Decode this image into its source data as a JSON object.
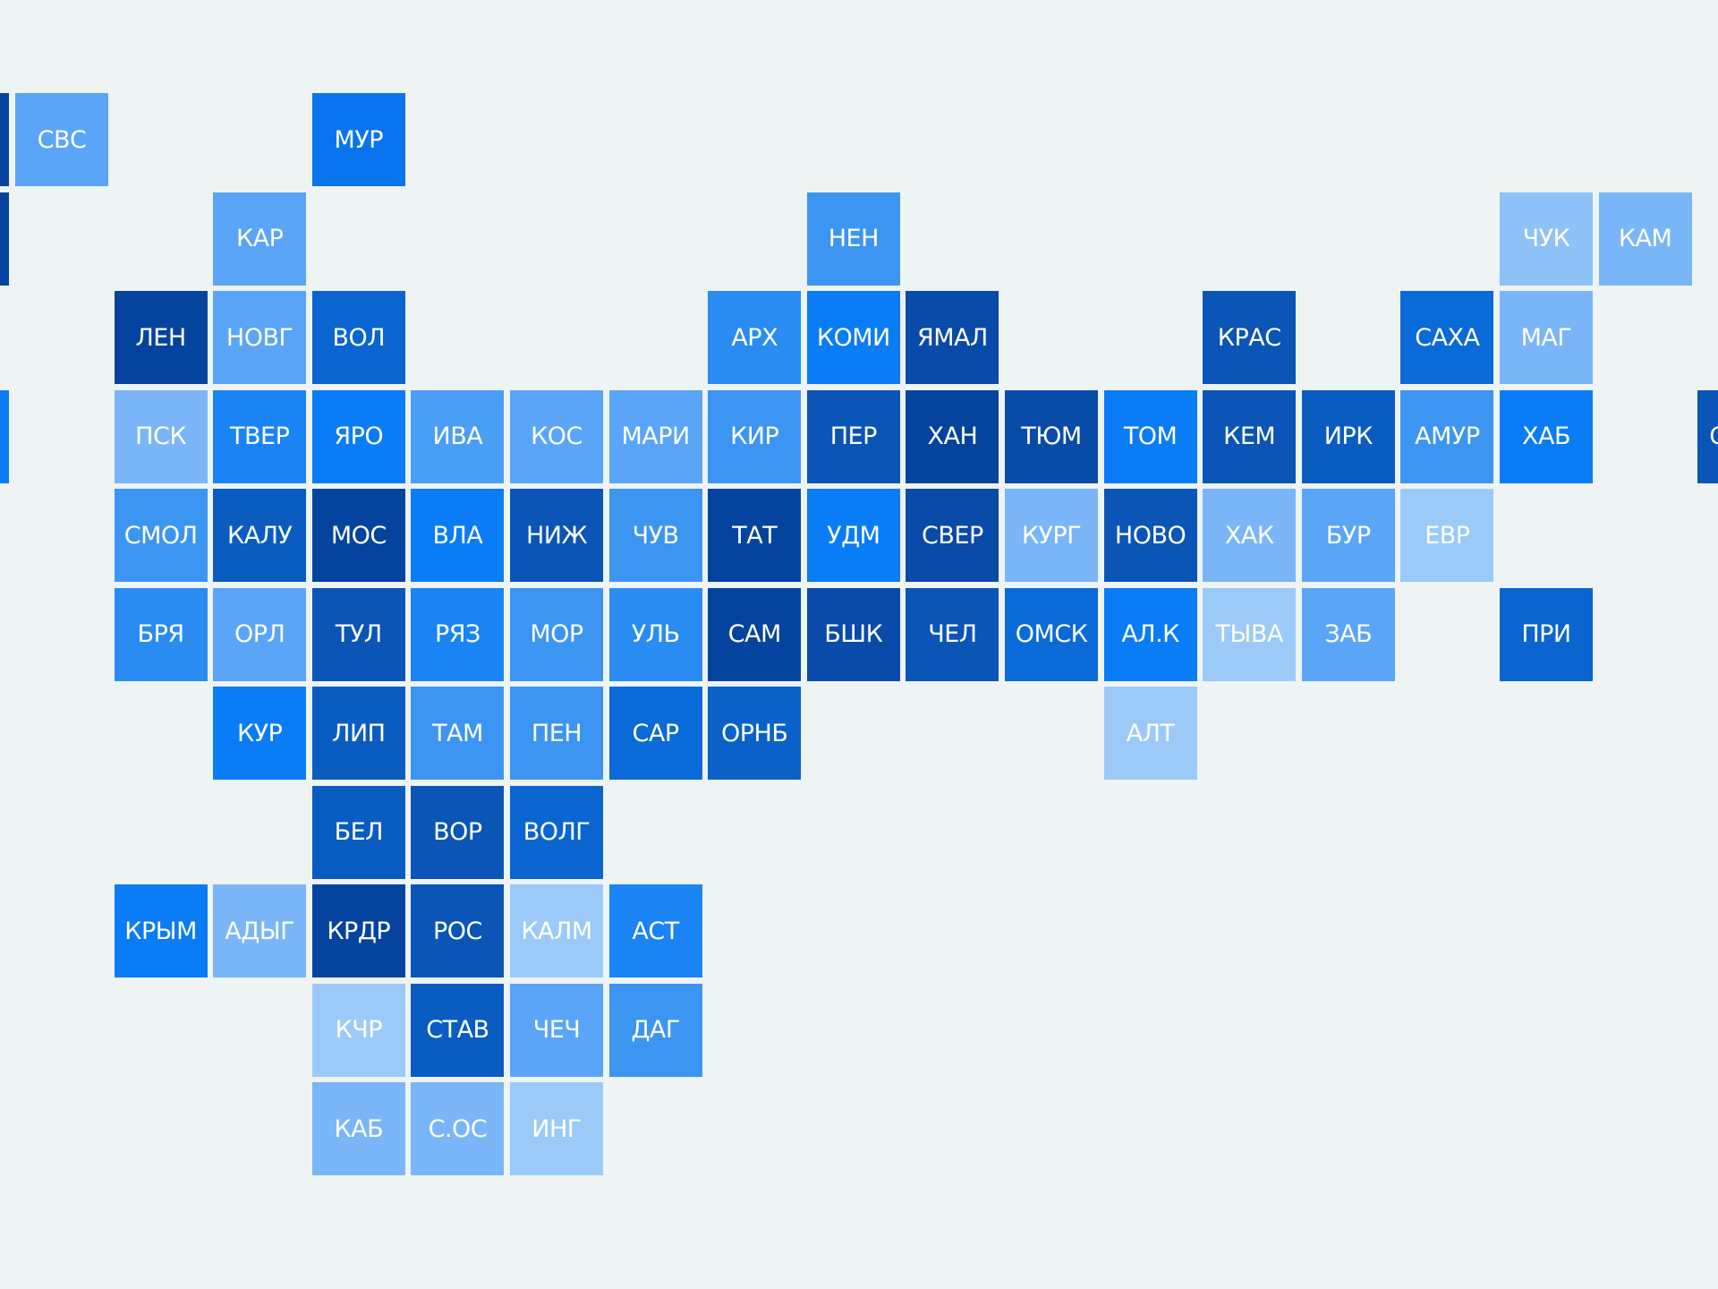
{
  "tiles": [
    {
      "label": "",
      "color": "#05449e"
    },
    {
      "label": "СВС",
      "color": "#5aa5f7"
    },
    {
      "label": "МУР",
      "color": "#0a74ee"
    },
    {
      "label": "",
      "color": "#05449e"
    },
    {
      "label": "КАР",
      "color": "#5aa5f7"
    },
    {
      "label": "НЕН",
      "color": "#3d95f2"
    },
    {
      "label": "ЧУК",
      "color": "#8ec2f8"
    },
    {
      "label": "КАМ",
      "color": "#7ab6f7"
    },
    {
      "label": "ЛЕН",
      "color": "#05449e"
    },
    {
      "label": "НОВГ",
      "color": "#5aa5f7"
    },
    {
      "label": "ВОЛ",
      "color": "#0a65d0"
    },
    {
      "label": "АРХ",
      "color": "#2a8cf2"
    },
    {
      "label": "КОМИ",
      "color": "#0a7cf5"
    },
    {
      "label": "ЯМАЛ",
      "color": "#0a4aa8"
    },
    {
      "label": "КРАС",
      "color": "#0a55b5"
    },
    {
      "label": "САХА",
      "color": "#0a6ad8"
    },
    {
      "label": "МАГ",
      "color": "#7ab6f7"
    },
    {
      "label": "",
      "color": "#0a7cf5"
    },
    {
      "label": "ПСК",
      "color": "#7ab6f7"
    },
    {
      "label": "ТВЕР",
      "color": "#1a84f5"
    },
    {
      "label": "ЯРО",
      "color": "#0a7cf5"
    },
    {
      "label": "ИВА",
      "color": "#4a9ef4"
    },
    {
      "label": "КОС",
      "color": "#5aa5f7"
    },
    {
      "label": "МАРИ",
      "color": "#5aa5f7"
    },
    {
      "label": "КИР",
      "color": "#3d95f2"
    },
    {
      "label": "ПЕР",
      "color": "#0a55b5"
    },
    {
      "label": "ХАН",
      "color": "#05449e"
    },
    {
      "label": "ТЮМ",
      "color": "#084ca8"
    },
    {
      "label": "ТОМ",
      "color": "#0a7cf5"
    },
    {
      "label": "КЕМ",
      "color": "#0a55b5"
    },
    {
      "label": "ИРК",
      "color": "#0a5cc0"
    },
    {
      "label": "АМУР",
      "color": "#3d95f2"
    },
    {
      "label": "ХАБ",
      "color": "#0a7cf5"
    },
    {
      "label": "С",
      "color": "#0a55b5"
    },
    {
      "label": "СМОЛ",
      "color": "#3d95f2"
    },
    {
      "label": "КАЛУ",
      "color": "#0a5cc0"
    },
    {
      "label": "МОС",
      "color": "#05449e"
    },
    {
      "label": "ВЛА",
      "color": "#0a7cf5"
    },
    {
      "label": "НИЖ",
      "color": "#0a55b5"
    },
    {
      "label": "ЧУВ",
      "color": "#3d95f2"
    },
    {
      "label": "ТАТ",
      "color": "#05449e"
    },
    {
      "label": "УДМ",
      "color": "#0a7cf5"
    },
    {
      "label": "СВЕР",
      "color": "#0a4aa8"
    },
    {
      "label": "КУРГ",
      "color": "#7ab6f7"
    },
    {
      "label": "НОВО",
      "color": "#0a55b5"
    },
    {
      "label": "ХАК",
      "color": "#7ab6f7"
    },
    {
      "label": "БУР",
      "color": "#5aa5f7"
    },
    {
      "label": "ЕВР",
      "color": "#9ccaf8"
    },
    {
      "label": "БРЯ",
      "color": "#2a8cf2"
    },
    {
      "label": "ОРЛ",
      "color": "#5aa5f7"
    },
    {
      "label": "ТУЛ",
      "color": "#0a55b5"
    },
    {
      "label": "РЯЗ",
      "color": "#1a84f5"
    },
    {
      "label": "МОР",
      "color": "#3d95f2"
    },
    {
      "label": "УЛЬ",
      "color": "#2a8cf2"
    },
    {
      "label": "САМ",
      "color": "#05449e"
    },
    {
      "label": "БШК",
      "color": "#0a4aa8"
    },
    {
      "label": "ЧЕЛ",
      "color": "#0a55b5"
    },
    {
      "label": "ОМСК",
      "color": "#0a6ad8"
    },
    {
      "label": "АЛ.К",
      "color": "#0a7cf5"
    },
    {
      "label": "ТЫВА",
      "color": "#9ccaf8"
    },
    {
      "label": "ЗАБ",
      "color": "#5aa5f7"
    },
    {
      "label": "ПРИ",
      "color": "#0a65d0"
    },
    {
      "label": "КУР",
      "color": "#0a7cf5"
    },
    {
      "label": "ЛИП",
      "color": "#0a5cc0"
    },
    {
      "label": "ТАМ",
      "color": "#3d95f2"
    },
    {
      "label": "ПЕН",
      "color": "#3d95f2"
    },
    {
      "label": "САР",
      "color": "#0a6ad8"
    },
    {
      "label": "ОРНБ",
      "color": "#0a62c8"
    },
    {
      "label": "АЛТ",
      "color": "#9ccaf8"
    },
    {
      "label": "БЕЛ",
      "color": "#0a5cc0"
    },
    {
      "label": "ВОР",
      "color": "#0a55b5"
    },
    {
      "label": "ВОЛГ",
      "color": "#0a65d0"
    },
    {
      "label": "КРЫМ",
      "color": "#0a7cf5"
    },
    {
      "label": "АДЫГ",
      "color": "#7ab6f7"
    },
    {
      "label": "КРДР",
      "color": "#05449e"
    },
    {
      "label": "РОС",
      "color": "#0a55b5"
    },
    {
      "label": "КАЛМ",
      "color": "#9ccaf8"
    },
    {
      "label": "АСТ",
      "color": "#1a84f5"
    },
    {
      "label": "КЧР",
      "color": "#9ccaf8"
    },
    {
      "label": "СТАВ",
      "color": "#0a5cc0"
    },
    {
      "label": "ЧЕЧ",
      "color": "#5aa5f7"
    },
    {
      "label": "ДАГ",
      "color": "#3d95f2"
    },
    {
      "label": "КАБ",
      "color": "#7ab6f7"
    },
    {
      "label": "С.ОС",
      "color": "#7ab6f7"
    },
    {
      "label": "ИНГ",
      "color": "#9ccaf8"
    }
  ]
}
